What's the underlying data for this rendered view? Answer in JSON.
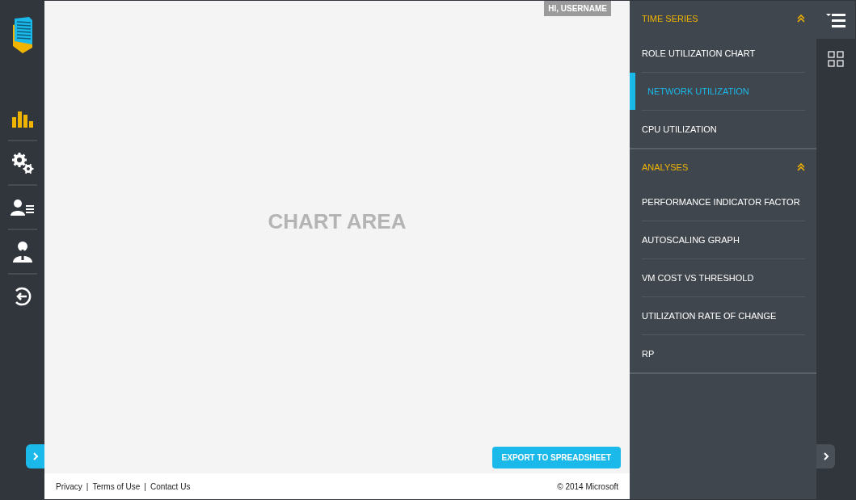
{
  "nav_rail": {
    "items": [
      {
        "kind": "chart",
        "selected": true
      },
      {
        "kind": "settings",
        "selected": false
      },
      {
        "kind": "users",
        "selected": false
      },
      {
        "kind": "admin",
        "selected": false
      },
      {
        "kind": "logout",
        "selected": false
      }
    ]
  },
  "greeting": "HI, USERNAME",
  "chart_area": {
    "label": "CHART AREA"
  },
  "export_button": "EXPORT TO SPREADSHEET",
  "footer": {
    "links": [
      "Privacy",
      "Terms of Use",
      "Contact Us"
    ],
    "separator": "|",
    "copyright": "© 2014 Microsoft"
  },
  "side_panel": {
    "sections": [
      {
        "title": "TIME SERIES",
        "expanded": true,
        "items": [
          {
            "label": "ROLE UTILIZATION CHART",
            "selected": false
          },
          {
            "label": "NETWORK UTILIZATION",
            "selected": true
          },
          {
            "label": "CPU UTILIZATION",
            "selected": false
          }
        ]
      },
      {
        "title": "ANALYSES",
        "expanded": true,
        "items": [
          {
            "label": "PERFORMANCE INDICATOR FACTOR",
            "selected": false
          },
          {
            "label": "AUTOSCALING GRAPH",
            "selected": false
          },
          {
            "label": "VM COST VS THRESHOLD",
            "selected": false
          },
          {
            "label": "UTILIZATION RATE OF CHANGE",
            "selected": false
          },
          {
            "label": "RP",
            "selected": false
          }
        ]
      }
    ]
  }
}
